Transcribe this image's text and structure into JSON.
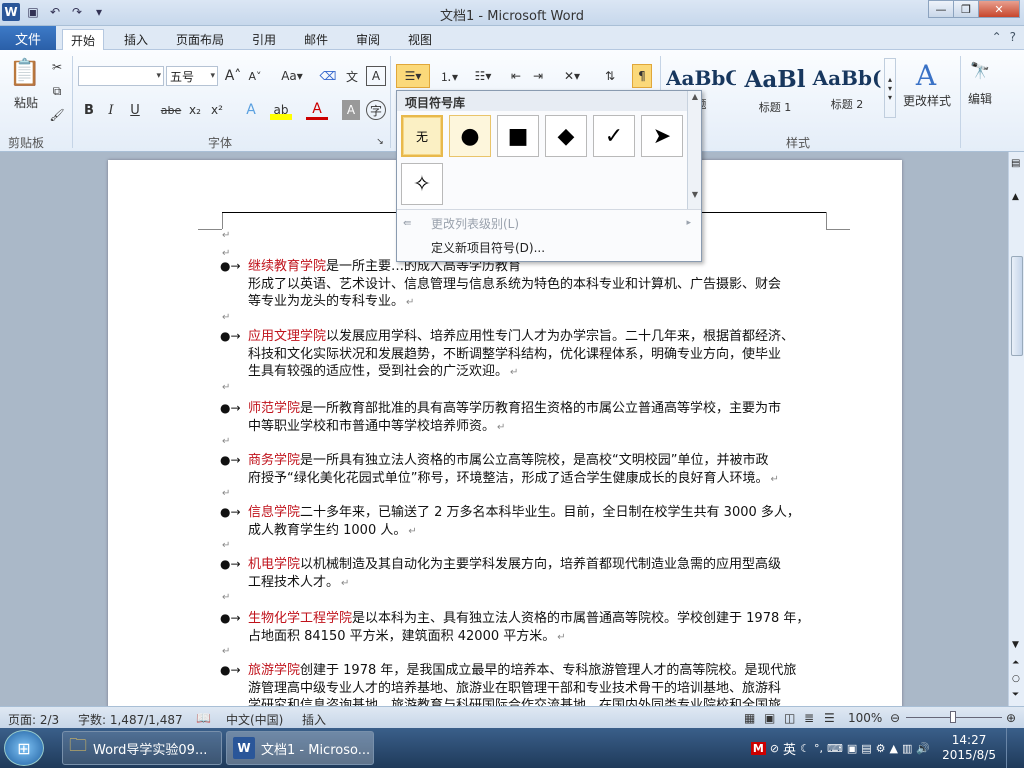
{
  "window": {
    "title": "文档1 - Microsoft Word"
  },
  "tabs": {
    "file": "文件",
    "items": [
      "开始",
      "插入",
      "页面布局",
      "引用",
      "邮件",
      "审阅",
      "视图"
    ]
  },
  "ribbon": {
    "clipboard": {
      "paste": "粘贴",
      "label": "剪贴板"
    },
    "font": {
      "name_value": "",
      "size_value": "五号",
      "label": "字体",
      "bold": "B",
      "italic": "I",
      "underline": "U",
      "strike": "abe",
      "sub": "x₂",
      "sup": "x²",
      "aa": "Aa",
      "grow": "A",
      "shrink": "A"
    },
    "styles": {
      "label": "样式",
      "items": [
        {
          "sample": "AaBbC",
          "name": "题"
        },
        {
          "sample": "AaBl",
          "name": "标题 1"
        },
        {
          "sample": "AaBb(",
          "name": "标题 2"
        }
      ],
      "change": "更改样式"
    },
    "edit": {
      "label": "编辑"
    }
  },
  "bullet_dropdown": {
    "heading": "项目符号库",
    "none_label": "无",
    "symbols": [
      "●",
      "■",
      "◆",
      "✓",
      "➤",
      "✧"
    ],
    "change_level": "更改列表级别(L)",
    "define_new": "定义新项目符号(D)..."
  },
  "document": {
    "paragraphs": [
      {
        "name": "继续教育学院",
        "text": "是一所主要…的成人高等学历教育",
        "line2": "形成了以英语、艺术设计、信息管理与信息系统为特色的本科专业和计算机、广告摄影、财会",
        "line3": "等专业为龙头的专科专业。"
      },
      {
        "name": "应用文理学院",
        "text": "以发展应用学科、培养应用性专门人才为办学宗旨。二十几年来，根据首都经济、",
        "line2": "科技和文化实际状况和发展趋势，不断调整学科结构，优化课程体系，明确专业方向，使毕业",
        "line3": "生具有较强的适应性，受到社会的广泛欢迎。"
      },
      {
        "name": "师范学院",
        "text": "是一所教育部批准的具有高等学历教育招生资格的市属公立普通高等学校，主要为市",
        "line2": "中等职业学校和市普通中等学校培养师资。",
        "line3": ""
      },
      {
        "name": "商务学院",
        "text": "是一所具有独立法人资格的市属公立高等院校，是高校“文明校园”单位，并被市政",
        "line2": "府授予“绿化美化花园式单位”称号，环境整洁，形成了适合学生健康成长的良好育人环境。",
        "line3": ""
      },
      {
        "name": "信息学院",
        "text": "二十多年来，已输送了 2 万多名本科毕业生。目前，全日制在校学生共有 3000 多人，",
        "line2": "成人教育学生约 1000 人。",
        "line3": ""
      },
      {
        "name": "机电学院",
        "text": "以机械制造及其自动化为主要学科发展方向，培养首都现代制造业急需的应用型高级",
        "line2": "工程技术人才。",
        "line3": ""
      },
      {
        "name": "生物化学工程学院",
        "text": "是以本科为主、具有独立法人资格的市属普通高等院校。学校创建于 1978 年，",
        "line2": "占地面积 84150 平方米，建筑面积 42000 平方米。",
        "line3": ""
      },
      {
        "name": "旅游学院",
        "text": "创建于 1978 年，是我国成立最早的培养本、专科旅游管理人才的高等院校。是现代旅",
        "line2": "游管理高中级专业人才的培养基地、旅游业在职管理干部和专业技术骨干的培训基地、旅游科",
        "line3": "学研究和信息咨询基地、旅游教育与科研国际合作交流基地，在国内外同类专业院校和全国旅"
      }
    ]
  },
  "status": {
    "page": "页面: 2/3",
    "words": "字数: 1,487/1,487",
    "lang": "中文(中国)",
    "mode": "插入",
    "zoom": "100%"
  },
  "taskbar": {
    "item1": "Word导学实验09...",
    "item2": "文档1 - Microso...",
    "ime": "英",
    "time": "14:27",
    "date": "2015/8/5"
  }
}
